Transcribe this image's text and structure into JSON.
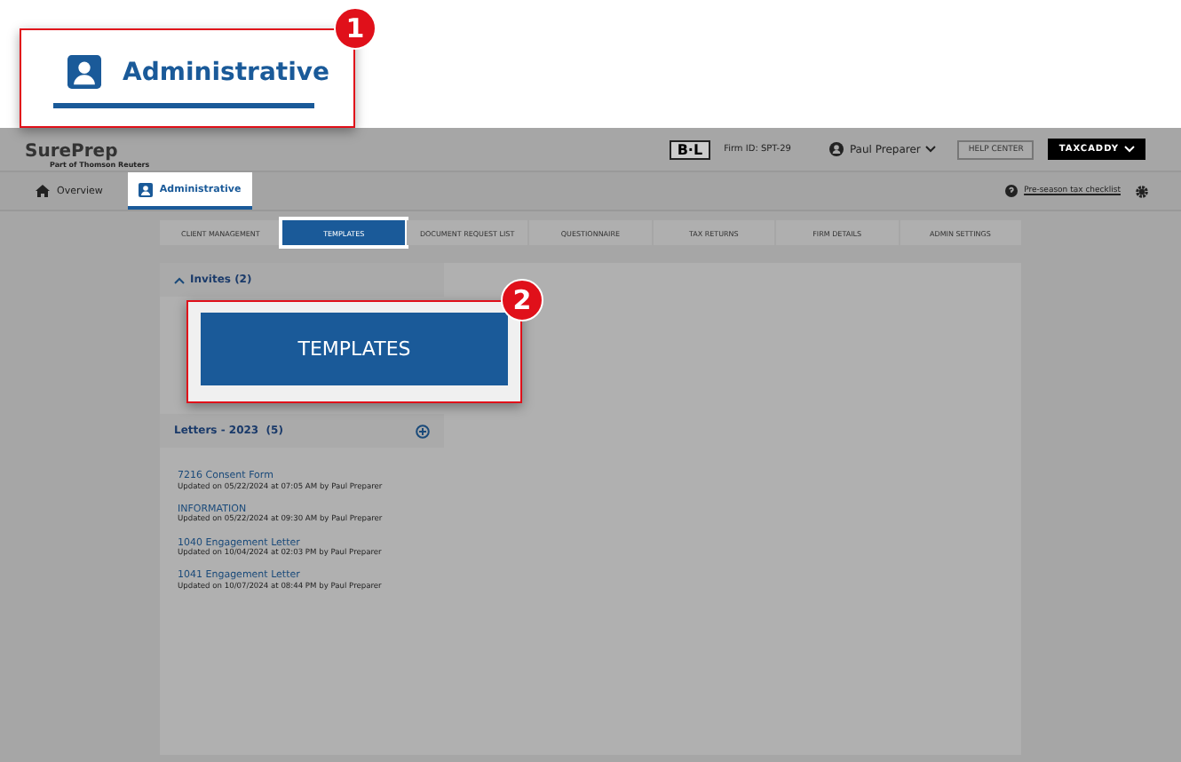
{
  "header": {
    "logo": "SurePrep",
    "logo_sub": "Part of Thomson Reuters",
    "firm_badge": "B·L",
    "firm_id": "Firm ID: SPT-29",
    "user": "Paul Preparer",
    "help": "HELP CENTER",
    "taxcaddy": "TAXCADDY"
  },
  "nav": {
    "tabs": [
      {
        "label": "Overview",
        "kind": "home",
        "selected": false
      },
      {
        "label": "Administrative",
        "kind": "user",
        "selected": true
      }
    ],
    "checklist": "Pre-season tax checklist"
  },
  "subtabs": [
    {
      "label": "CLIENT MANAGEMENT",
      "selected": false
    },
    {
      "label": "TEMPLATES",
      "selected": true
    },
    {
      "label": "DOCUMENT REQUEST LIST",
      "selected": false
    },
    {
      "label": "QUESTIONNAIRE",
      "selected": false
    },
    {
      "label": "TAX RETURNS",
      "selected": false
    },
    {
      "label": "FIRM DETAILS",
      "selected": false
    },
    {
      "label": "ADMIN SETTINGS",
      "selected": false
    }
  ],
  "invites": {
    "title": "Invites (2)",
    "expanded": true
  },
  "letters": {
    "title": "Letters - 2023",
    "count": "(5)",
    "items": [
      {
        "name": "7216 Consent Form",
        "updated": "Updated on 05/22/2024 at 07:05 AM by Paul Preparer"
      },
      {
        "name": "INFORMATION",
        "updated": "Updated on 05/22/2024 at 09:30 AM by Paul Preparer"
      },
      {
        "name": "1040 Engagement Letter",
        "updated": "Updated on 10/04/2024 at 02:03 PM by Paul Preparer"
      },
      {
        "name": "1041 Engagement Letter",
        "updated": "Updated on 10/07/2024 at 08:44 PM by Paul Preparer"
      }
    ]
  },
  "callouts": [
    {
      "number": "1",
      "label": "Administrative",
      "kind": "tab"
    },
    {
      "number": "2",
      "label": "TEMPLATES",
      "kind": "button"
    }
  ]
}
